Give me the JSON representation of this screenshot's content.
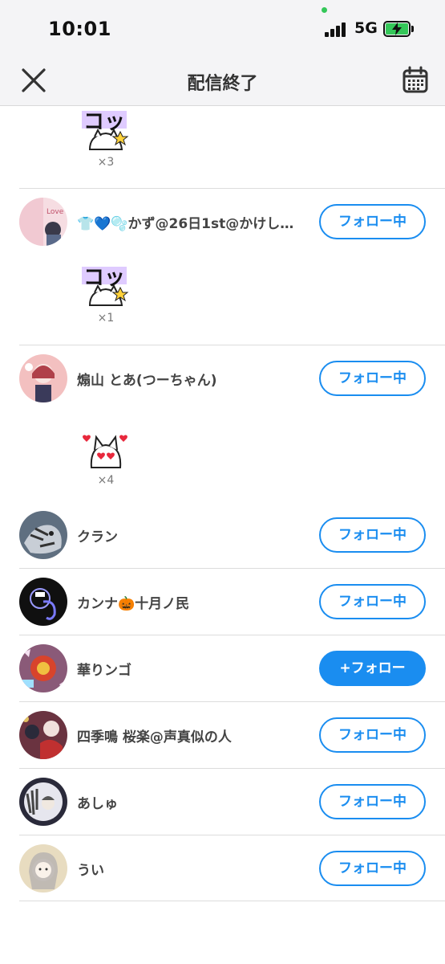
{
  "status_bar": {
    "time": "10:01",
    "network": "5G"
  },
  "header": {
    "title": "配信終了"
  },
  "icons": {
    "close": "close-icon",
    "calendar": "calendar-icon",
    "sticker_a": "kotsu-cat-sticker",
    "sticker_b": "heart-cat-sticker"
  },
  "colors": {
    "accent": "#1a8df0",
    "battery": "#34c759",
    "avatar_placeholders": [
      "#f1c9d2",
      "#f3c0c0",
      "#5f6f80",
      "#101010",
      "#8a5a78",
      "#6a3340",
      "#2a2a3a",
      "#e8dcc0"
    ]
  },
  "gifts": [
    {
      "count": "×3"
    },
    {
      "count": "×1"
    },
    {
      "count": "×4"
    }
  ],
  "users": [
    {
      "name": "👕💙🫧かず@26日1st@かけしゃ…",
      "button": "フォロー中"
    },
    {
      "name": "煽山 とあ(つーちゃん)",
      "button": "フォロー中"
    },
    {
      "name": "クラン",
      "button": "フォロー中"
    },
    {
      "name": "カンナ🎃十月ノ民",
      "button": "フォロー中"
    },
    {
      "name": "華りンゴ",
      "button": "+フォロー"
    },
    {
      "name": "四季鳴 桜楽@声真似の人",
      "button": "フォロー中"
    },
    {
      "name": "あしゅ",
      "button": "フォロー中"
    },
    {
      "name": "うい",
      "button": "フォロー中"
    }
  ]
}
